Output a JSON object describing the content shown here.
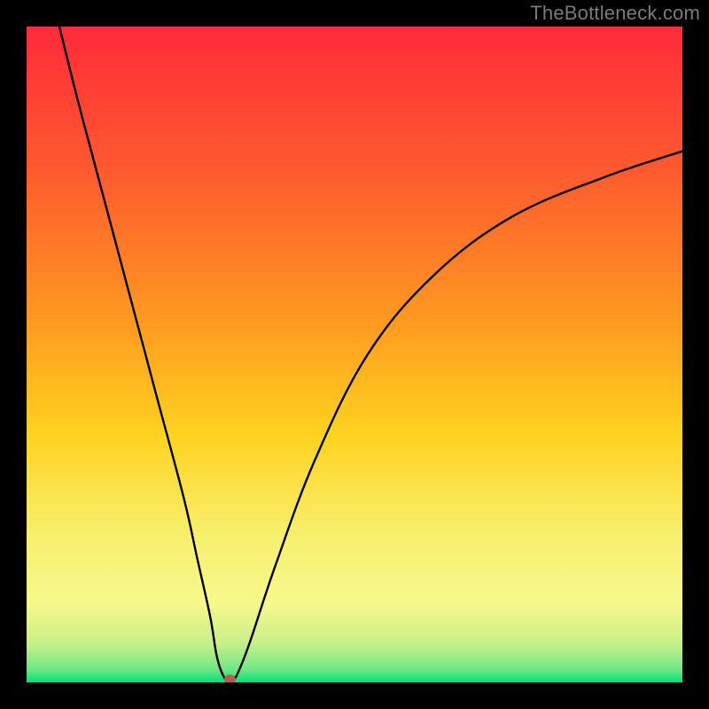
{
  "watermark": "TheBottleneck.com",
  "colors": {
    "top": "#ff2a3a",
    "upper_mid": "#ff7a2a",
    "mid": "#ffd21f",
    "lower_mid": "#f7f88c",
    "near_bottom": "#b7f07a",
    "bottom": "#00e07a",
    "curve": "#000000",
    "marker": "#c0574e",
    "frame_bg": "#000000"
  },
  "chart_data": {
    "type": "line",
    "title": "",
    "xlabel": "",
    "ylabel": "",
    "xlim": [
      0,
      100
    ],
    "ylim": [
      0,
      100
    ],
    "grid": false,
    "legend": false,
    "x": [
      5,
      8,
      12,
      16,
      20,
      24,
      26,
      28,
      29,
      30,
      31,
      32,
      34,
      38,
      44,
      52,
      62,
      74,
      88,
      100
    ],
    "y": [
      100,
      88,
      73,
      58,
      43,
      28,
      19,
      10,
      4,
      1,
      0,
      1,
      6,
      18,
      34,
      50,
      62,
      71,
      77,
      81
    ],
    "marker_point": {
      "x": 31,
      "y": 0.5
    },
    "notes": "Heatmap-style vertical gradient background (red→orange→yellow→green). Single black V-shaped curve dipping to baseline near x≈31. One small red/brown marker at the trough. No axes, ticks, or labels are shown."
  }
}
